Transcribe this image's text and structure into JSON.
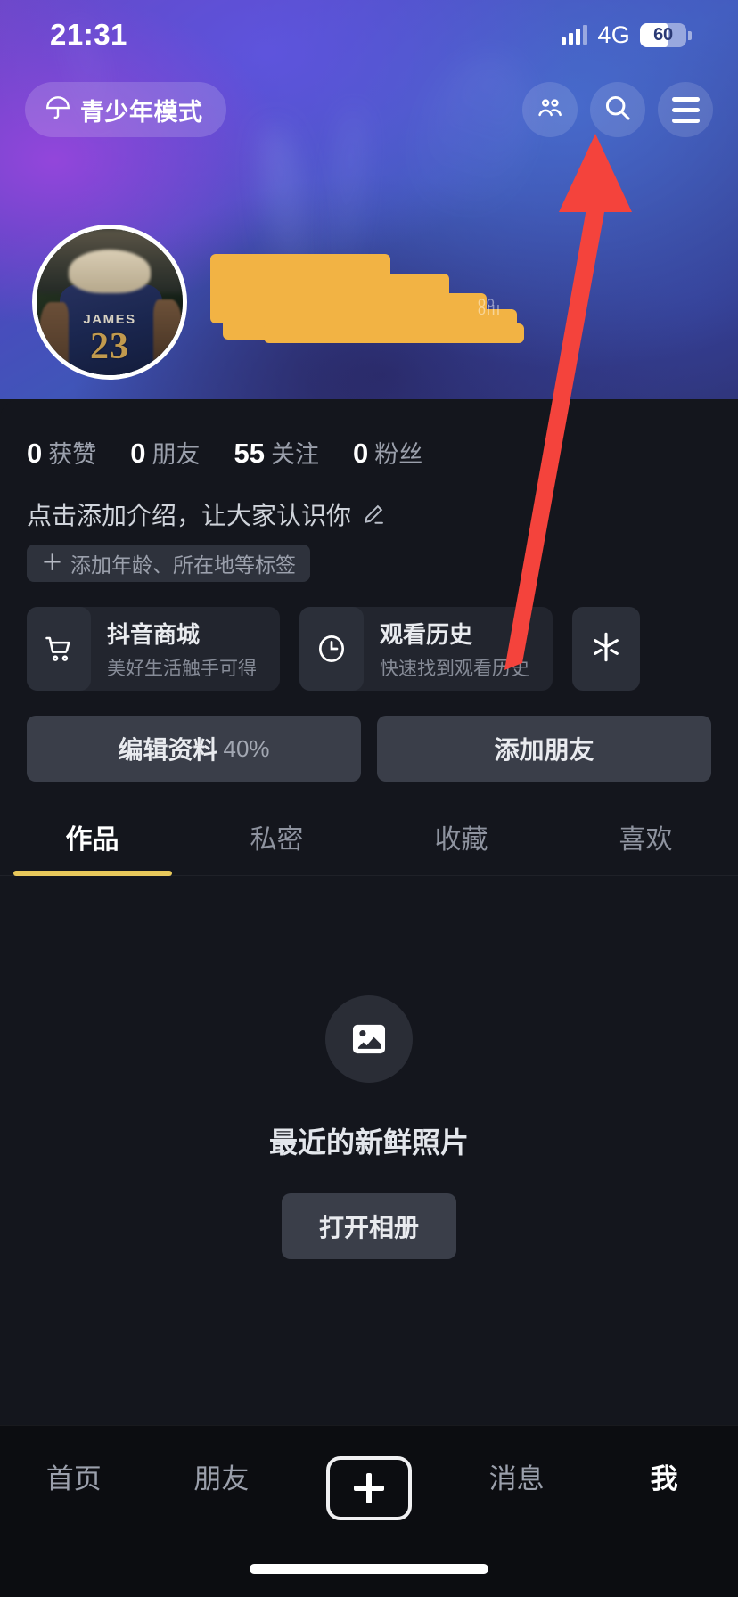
{
  "status_bar": {
    "time": "21:31",
    "network": "4G",
    "battery_percent": "60",
    "signal_icon": "signal-bars-icon",
    "battery_icon": "battery-icon"
  },
  "header": {
    "teen_mode_label": "青少年模式",
    "teen_mode_icon": "umbrella-icon",
    "friends_icon": "friends-icon",
    "search_icon": "search-icon",
    "menu_icon": "hamburger-menu-icon"
  },
  "profile": {
    "avatar_icon": "user-avatar",
    "avatar_jersey_name": "JAMES",
    "avatar_jersey_number": "23",
    "username_redacted": true,
    "redaction_color": "#f2b344"
  },
  "stats": [
    {
      "value": "0",
      "label": "获赞"
    },
    {
      "value": "0",
      "label": "朋友"
    },
    {
      "value": "55",
      "label": "关注"
    },
    {
      "value": "0",
      "label": "粉丝"
    }
  ],
  "bio": {
    "placeholder": "点击添加介绍，让大家认识你",
    "edit_icon": "pencil-icon",
    "tag_plus": "＋",
    "tag_label": "添加年龄、所在地等标签"
  },
  "shortcut_cards": [
    {
      "title": "抖音商城",
      "subtitle": "美好生活触手可得",
      "icon": "shopping-cart-icon"
    },
    {
      "title": "观看历史",
      "subtitle": "快速找到观看历史",
      "icon": "clock-icon"
    }
  ],
  "shortcut_card_partial": {
    "icon": "starburst-icon"
  },
  "actions": {
    "edit_profile_label": "编辑资料",
    "edit_profile_percent": "40%",
    "add_friend_label": "添加朋友"
  },
  "tabs": [
    {
      "label": "作品",
      "active": true
    },
    {
      "label": "私密",
      "active": false
    },
    {
      "label": "收藏",
      "active": false
    },
    {
      "label": "喜欢",
      "active": false
    }
  ],
  "tab_indicator_color": "#e8c85a",
  "empty_state": {
    "icon": "photo-icon",
    "title": "最近的新鲜照片",
    "button_label": "打开相册"
  },
  "bottom_nav": [
    {
      "label": "首页",
      "active": false
    },
    {
      "label": "朋友",
      "active": false
    },
    {
      "label": "",
      "active": false,
      "icon": "plus-create-icon"
    },
    {
      "label": "消息",
      "active": false
    },
    {
      "label": "我",
      "active": true
    }
  ],
  "annotation": {
    "arrow_color": "#f4433c",
    "points_to": "hamburger-menu-icon"
  }
}
